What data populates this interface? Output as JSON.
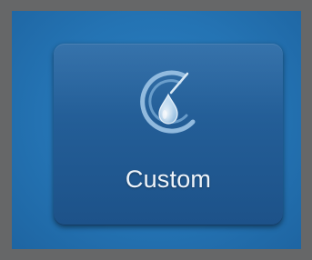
{
  "mode_tile": {
    "label": "Custom",
    "icon": "custom-droplet-dial-icon"
  },
  "colors": {
    "bezel": "#666768",
    "screen_background": "#2473b3",
    "tile_background": "#235d96",
    "icon_stroke": "#b8d6ee",
    "label_text": "#eef4fa"
  }
}
